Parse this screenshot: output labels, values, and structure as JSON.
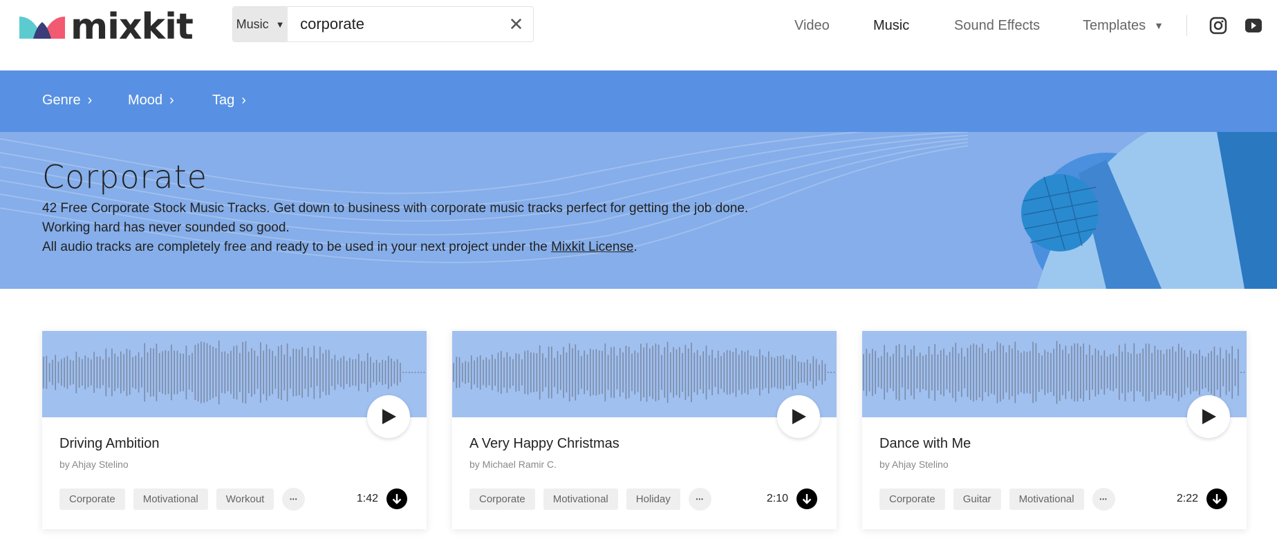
{
  "header": {
    "logo_text": "mixkit",
    "search": {
      "category": "Music",
      "query": "corporate"
    },
    "nav": [
      {
        "label": "Video",
        "active": false
      },
      {
        "label": "Music",
        "active": true
      },
      {
        "label": "Sound Effects",
        "active": false
      },
      {
        "label": "Templates",
        "active": false,
        "dropdown": true
      }
    ],
    "social_icons": [
      "instagram-icon",
      "youtube-icon"
    ]
  },
  "subnav": {
    "items": [
      {
        "label": "Genre"
      },
      {
        "label": "Mood"
      },
      {
        "label": "Tag"
      }
    ]
  },
  "hero": {
    "title": "Corporate",
    "line1": "42 Free Corporate Stock Music Tracks. Get down to business with corporate music tracks perfect for getting the job done.",
    "line2": "Working hard has never sounded so good.",
    "line3_prefix": "All audio tracks are completely free and ready to be used in your next project under the ",
    "line3_link": "Mixkit License",
    "line3_suffix": "."
  },
  "tracks": [
    {
      "title": "Driving Ambition",
      "author": "by Ahjay Stelino",
      "tags": [
        "Corporate",
        "Motivational",
        "Workout"
      ],
      "duration": "1:42"
    },
    {
      "title": "A Very Happy Christmas",
      "author": "by Michael Ramir C.",
      "tags": [
        "Corporate",
        "Motivational",
        "Holiday"
      ],
      "duration": "2:10"
    },
    {
      "title": "Dance with Me",
      "author": "by Ahjay Stelino",
      "tags": [
        "Corporate",
        "Guitar",
        "Motivational"
      ],
      "duration": "2:22"
    }
  ],
  "colors": {
    "subnav_bg": "#5891e3",
    "hero_bg": "#85aeea",
    "waveform_bg": "#a0c0f0",
    "logo_teal": "#5ccbd0",
    "logo_pink": "#f25a72",
    "logo_navy": "#3a3d7a"
  }
}
